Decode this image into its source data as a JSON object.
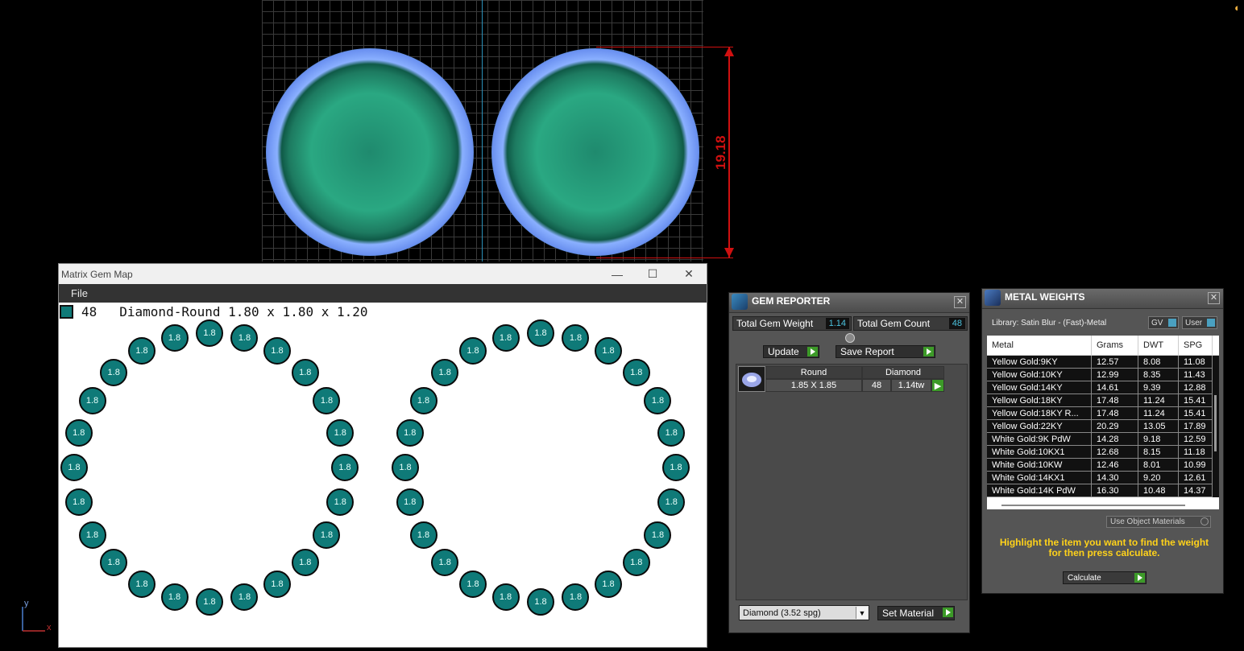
{
  "viewport": {
    "dimension_value": "19.18",
    "axis_y": "y",
    "axis_x": "x"
  },
  "gem_map": {
    "window_title": "Matrix Gem Map",
    "menu_file": "File",
    "legend_count": "48",
    "legend_desc": "Diamond-Round 1.80 x 1.80 x 1.20",
    "gem_label": "1.8",
    "swatch_color": "#0f7a78"
  },
  "gem_reporter": {
    "title": "GEM REPORTER",
    "total_weight_label": "Total Gem Weight",
    "total_weight_value": "1.14",
    "total_count_label": "Total Gem Count",
    "total_count_value": "48",
    "update_label": "Update",
    "save_report_label": "Save Report",
    "col_shape": "Round",
    "col_material": "Diamond",
    "row_size": "1.85 X 1.85",
    "row_count": "48",
    "row_weight": "1.14tw",
    "material_select": "Diamond    (3.52 spg)",
    "set_material_label": "Set Material"
  },
  "metal_weights": {
    "title": "METAL WEIGHTS",
    "library": "Library: Satin Blur - (Fast)-Metal",
    "toggle_gv": "GV",
    "toggle_user": "User",
    "columns": [
      "Metal",
      "Grams",
      "DWT",
      "SPG"
    ],
    "rows": [
      [
        "Yellow Gold:9KY",
        "12.57",
        "8.08",
        "11.08"
      ],
      [
        "Yellow Gold:10KY",
        "12.99",
        "8.35",
        "11.43"
      ],
      [
        "Yellow Gold:14KY",
        "14.61",
        "9.39",
        "12.88"
      ],
      [
        "Yellow Gold:18KY",
        "17.48",
        "11.24",
        "15.41"
      ],
      [
        "Yellow Gold:18KY R...",
        "17.48",
        "11.24",
        "15.41"
      ],
      [
        "Yellow Gold:22KY",
        "20.29",
        "13.05",
        "17.89"
      ],
      [
        "White Gold:9K PdW",
        "14.28",
        "9.18",
        "12.59"
      ],
      [
        "White Gold:10KX1",
        "12.68",
        "8.15",
        "11.18"
      ],
      [
        "White Gold:10KW",
        "12.46",
        "8.01",
        "10.99"
      ],
      [
        "White Gold:14KX1",
        "14.30",
        "9.20",
        "12.61"
      ],
      [
        "White Gold:14K PdW",
        "16.30",
        "10.48",
        "14.37"
      ]
    ],
    "use_object_materials": "Use Object Materials",
    "hint": "Highlight the item you want to find the weight for then press calculate.",
    "calculate_label": "Calculate"
  }
}
